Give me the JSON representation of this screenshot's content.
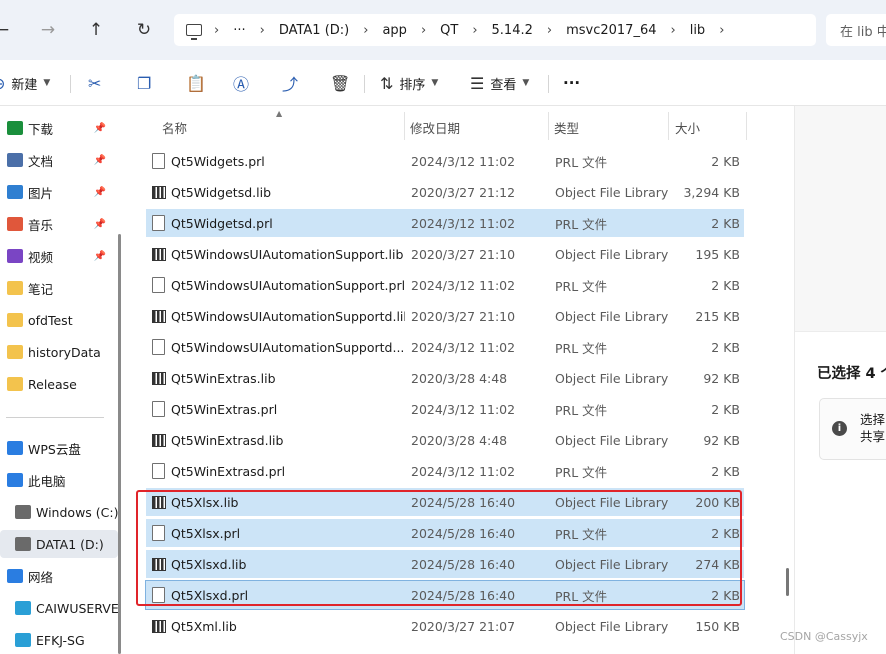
{
  "addressbar": {
    "back_icon": "arrow-left-icon",
    "forward_icon": "arrow-right-icon",
    "up_icon": "arrow-up-icon",
    "refresh_icon": "refresh-icon",
    "overflow": "···",
    "path": [
      "DATA1 (D:)",
      "app",
      "QT",
      "5.14.2",
      "msvc2017_64",
      "lib"
    ],
    "search_placeholder": "在 lib 中"
  },
  "commandbar": {
    "new_label": "新建",
    "sort_label": "排序",
    "view_label": "查看",
    "more_label": "···"
  },
  "sidebar": {
    "quick": [
      {
        "label": "下载",
        "color": "#1a8f3c",
        "pinned": true
      },
      {
        "label": "文档",
        "color": "#4b6fa8",
        "pinned": true
      },
      {
        "label": "图片",
        "color": "#2f7fd1",
        "pinned": true
      },
      {
        "label": "音乐",
        "color": "#e0573b",
        "pinned": true
      },
      {
        "label": "视频",
        "color": "#7a45c4",
        "pinned": true
      },
      {
        "label": "笔记",
        "color": "#f3c34d",
        "pinned": false
      },
      {
        "label": "ofdTest",
        "color": "#f3c34d",
        "pinned": false
      },
      {
        "label": "historyData",
        "color": "#f3c34d",
        "pinned": false
      },
      {
        "label": "Release",
        "color": "#f3c34d",
        "pinned": false
      }
    ],
    "locations": [
      {
        "label": "WPS云盘",
        "color": "#2a7de1",
        "indent": 0,
        "active": false
      },
      {
        "label": "此电脑",
        "color": "#2a7de1",
        "indent": 0,
        "active": false
      },
      {
        "label": "Windows (C:)",
        "color": "#6a6a6a",
        "indent": 1,
        "active": false
      },
      {
        "label": "DATA1 (D:)",
        "color": "#6a6a6a",
        "indent": 1,
        "active": true
      },
      {
        "label": "网络",
        "color": "#2a7de1",
        "indent": 0,
        "active": false
      },
      {
        "label": "CAIWUSERVER",
        "color": "#2a9fd6",
        "indent": 1,
        "active": false
      },
      {
        "label": "EFKJ-SG",
        "color": "#2a9fd6",
        "indent": 1,
        "active": false
      }
    ]
  },
  "columns": {
    "name": "名称",
    "date": "修改日期",
    "type": "类型",
    "size": "大小"
  },
  "files": [
    {
      "name": "Qt5Widgets.prl",
      "date": "2024/3/12 11:02",
      "type": "PRL 文件",
      "size": "2 KB",
      "kind": "doc",
      "selected": false
    },
    {
      "name": "Qt5Widgetsd.lib",
      "date": "2020/3/27 21:12",
      "type": "Object File Library",
      "size": "3,294 KB",
      "kind": "lib",
      "selected": false
    },
    {
      "name": "Qt5Widgetsd.prl",
      "date": "2024/3/12 11:02",
      "type": "PRL 文件",
      "size": "2 KB",
      "kind": "doc",
      "selected": true
    },
    {
      "name": "Qt5WindowsUIAutomationSupport.lib",
      "date": "2020/3/27 21:10",
      "type": "Object File Library",
      "size": "195 KB",
      "kind": "lib",
      "selected": false
    },
    {
      "name": "Qt5WindowsUIAutomationSupport.prl",
      "date": "2024/3/12 11:02",
      "type": "PRL 文件",
      "size": "2 KB",
      "kind": "doc",
      "selected": false
    },
    {
      "name": "Qt5WindowsUIAutomationSupportd.lib",
      "date": "2020/3/27 21:10",
      "type": "Object File Library",
      "size": "215 KB",
      "kind": "lib",
      "selected": false
    },
    {
      "name": "Qt5WindowsUIAutomationSupportd....",
      "date": "2024/3/12 11:02",
      "type": "PRL 文件",
      "size": "2 KB",
      "kind": "doc",
      "selected": false
    },
    {
      "name": "Qt5WinExtras.lib",
      "date": "2020/3/28 4:48",
      "type": "Object File Library",
      "size": "92 KB",
      "kind": "lib",
      "selected": false
    },
    {
      "name": "Qt5WinExtras.prl",
      "date": "2024/3/12 11:02",
      "type": "PRL 文件",
      "size": "2 KB",
      "kind": "doc",
      "selected": false
    },
    {
      "name": "Qt5WinExtrasd.lib",
      "date": "2020/3/28 4:48",
      "type": "Object File Library",
      "size": "92 KB",
      "kind": "lib",
      "selected": false
    },
    {
      "name": "Qt5WinExtrasd.prl",
      "date": "2024/3/12 11:02",
      "type": "PRL 文件",
      "size": "2 KB",
      "kind": "doc",
      "selected": false
    },
    {
      "name": "Qt5Xlsx.lib",
      "date": "2024/5/28 16:40",
      "type": "Object File Library",
      "size": "200 KB",
      "kind": "lib",
      "selected": true
    },
    {
      "name": "Qt5Xlsx.prl",
      "date": "2024/5/28 16:40",
      "type": "PRL 文件",
      "size": "2 KB",
      "kind": "doc",
      "selected": true
    },
    {
      "name": "Qt5Xlsxd.lib",
      "date": "2024/5/28 16:40",
      "type": "Object File Library",
      "size": "274 KB",
      "kind": "lib",
      "selected": true
    },
    {
      "name": "Qt5Xlsxd.prl",
      "date": "2024/5/28 16:40",
      "type": "PRL 文件",
      "size": "2 KB",
      "kind": "doc",
      "selected": true,
      "focus": true
    },
    {
      "name": "Qt5Xml.lib",
      "date": "2020/3/27 21:07",
      "type": "Object File Library",
      "size": "150 KB",
      "kind": "lib",
      "selected": false
    }
  ],
  "details": {
    "selected_title": "已选择 4 个",
    "info_text": "选择\n共享",
    "info_icon": "info-icon"
  },
  "watermark": "CSDN @Cassyjx",
  "colors": {
    "selection": "#cce4f7",
    "highlight_box": "#e0242a",
    "accent": "#2a5db0"
  }
}
